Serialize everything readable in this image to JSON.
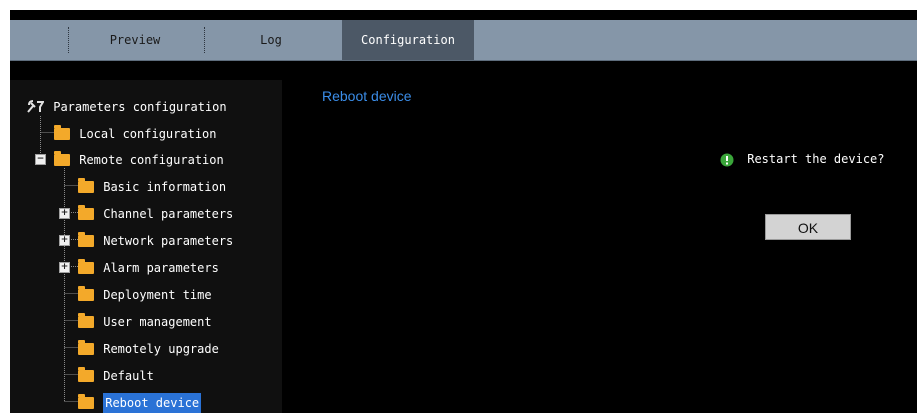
{
  "tabs": {
    "preview": "Preview",
    "log": "Log",
    "configuration": "Configuration"
  },
  "tree": {
    "root": "Parameters configuration",
    "items": [
      {
        "label": "Local configuration"
      },
      {
        "label": "Remote configuration"
      },
      {
        "label": "Basic information"
      },
      {
        "label": "Channel parameters"
      },
      {
        "label": "Network parameters"
      },
      {
        "label": "Alarm parameters"
      },
      {
        "label": "Deployment time"
      },
      {
        "label": "User management"
      },
      {
        "label": "Remotely upgrade"
      },
      {
        "label": "Default"
      },
      {
        "label": "Reboot device"
      }
    ]
  },
  "content": {
    "title": "Reboot device",
    "prompt": "Restart the device?",
    "ok_label": "OK"
  },
  "colors": {
    "topbar": "#8596a8",
    "active_tab": "#4c5866",
    "title": "#3b8de8",
    "selection": "#2a72d6",
    "folder": "#f3a92a",
    "prompt_icon": "#3aa63a"
  }
}
